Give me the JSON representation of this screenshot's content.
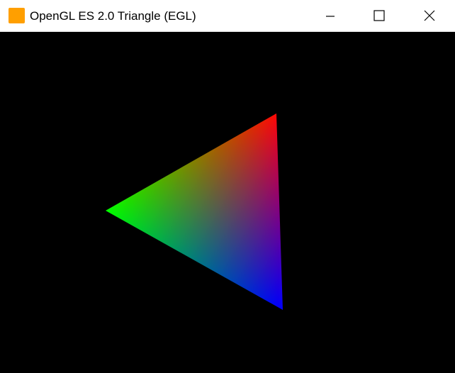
{
  "window": {
    "title": "OpenGL ES 2.0 Triangle (EGL)",
    "icon": "app-icon",
    "icon_color": "#FF9F00",
    "controls": {
      "minimize_icon": "minimize-icon",
      "maximize_icon": "maximize-icon",
      "close_icon": "close-icon"
    }
  },
  "scene": {
    "background_color": "#000000",
    "triangle_vertex_colors": [
      "#FF0000",
      "#00FF00",
      "#0000FF"
    ]
  }
}
